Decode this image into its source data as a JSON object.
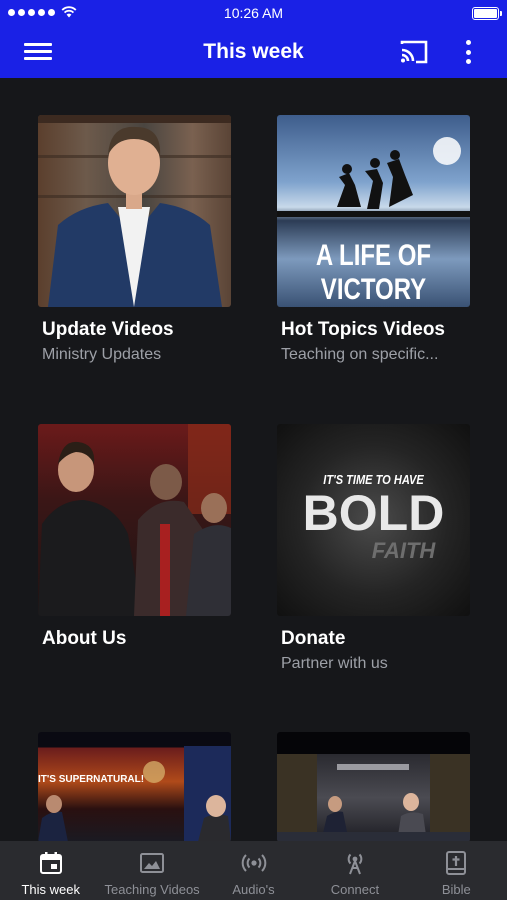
{
  "status_bar": {
    "time": "10:26 AM",
    "signal_icon": "signal-dots-icon",
    "wifi_icon": "wifi-icon",
    "battery_icon": "battery-icon"
  },
  "app_bar": {
    "title": "This week",
    "menu_icon": "hamburger-menu-icon",
    "cast_icon": "cast-icon",
    "more_icon": "more-vertical-icon",
    "background_color": "#1a21e6"
  },
  "cards": [
    {
      "title": "Update Videos",
      "subtitle": "Ministry Updates"
    },
    {
      "title": "Hot Topics Videos",
      "subtitle": "Teaching on specific...",
      "thumb_text": [
        "A LIFE OF",
        "VICTORY"
      ]
    },
    {
      "title": "About Us",
      "subtitle": ""
    },
    {
      "title": "Donate",
      "subtitle": "Partner with us",
      "thumb_text": [
        "IT'S TIME TO HAVE",
        "BOLD",
        "FAITH"
      ]
    },
    {
      "thumb_text": [
        "IT'S SUPERNATURAL!"
      ]
    },
    {}
  ],
  "tabs": [
    {
      "label": "This week",
      "icon": "calendar-icon",
      "active": true
    },
    {
      "label": "Teaching Videos",
      "icon": "image-icon",
      "active": false
    },
    {
      "label": "Audio's",
      "icon": "broadcast-icon",
      "active": false
    },
    {
      "label": "Connect",
      "icon": "antenna-icon",
      "active": false
    },
    {
      "label": "Bible",
      "icon": "bible-icon",
      "active": false
    }
  ]
}
